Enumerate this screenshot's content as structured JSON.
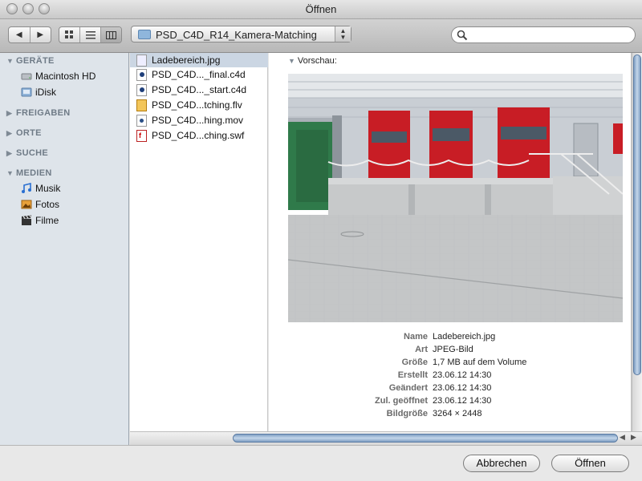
{
  "window": {
    "title": "Öffnen"
  },
  "toolbar": {
    "back_label": "◀",
    "forward_label": "▶",
    "location": "PSD_C4D_R14_Kamera-Matching",
    "search": {
      "value": "",
      "placeholder": ""
    }
  },
  "sidebar": {
    "sections": [
      {
        "label": "GERÄTE",
        "expanded": true,
        "items": [
          {
            "label": "Macintosh HD",
            "icon": "harddisk-icon"
          },
          {
            "label": "iDisk",
            "icon": "idisk-icon"
          }
        ]
      },
      {
        "label": "FREIGABEN",
        "expanded": false,
        "items": []
      },
      {
        "label": "ORTE",
        "expanded": false,
        "items": []
      },
      {
        "label": "SUCHE",
        "expanded": false,
        "items": []
      },
      {
        "label": "MEDIEN",
        "expanded": true,
        "items": [
          {
            "label": "Musik",
            "icon": "music-icon"
          },
          {
            "label": "Fotos",
            "icon": "photos-icon"
          },
          {
            "label": "Filme",
            "icon": "film-icon"
          }
        ]
      }
    ]
  },
  "files": [
    {
      "name": "Ladebereich.jpg",
      "icon": "jpg-file-icon",
      "selected": true
    },
    {
      "name": "PSD_C4D..._final.c4d",
      "icon": "c4d-file-icon",
      "selected": false
    },
    {
      "name": "PSD_C4D..._start.c4d",
      "icon": "c4d-file-icon",
      "selected": false
    },
    {
      "name": "PSD_C4D...tching.flv",
      "icon": "flv-file-icon",
      "selected": false
    },
    {
      "name": "PSD_C4D...hing.mov",
      "icon": "mov-file-icon",
      "selected": false
    },
    {
      "name": "PSD_C4D...ching.swf",
      "icon": "swf-file-icon",
      "selected": false
    }
  ],
  "preview": {
    "header": "Vorschau:",
    "info": [
      {
        "key": "Name",
        "value": "Ladebereich.jpg"
      },
      {
        "key": "Art",
        "value": "JPEG-Bild"
      },
      {
        "key": "Größe",
        "value": "1,7 MB auf dem Volume"
      },
      {
        "key": "Erstellt",
        "value": "23.06.12 14:30"
      },
      {
        "key": "Geändert",
        "value": "23.06.12 14:30"
      },
      {
        "key": "Zul. geöffnet",
        "value": "23.06.12 14:30"
      },
      {
        "key": "Bildgröße",
        "value": "3264 × 2448"
      }
    ]
  },
  "buttons": {
    "cancel": "Abbrechen",
    "open": "Öffnen"
  },
  "colors": {
    "selection": "#cbd6e3",
    "sidebar_bg": "#dee4ea",
    "door_red": "#c81d25"
  }
}
